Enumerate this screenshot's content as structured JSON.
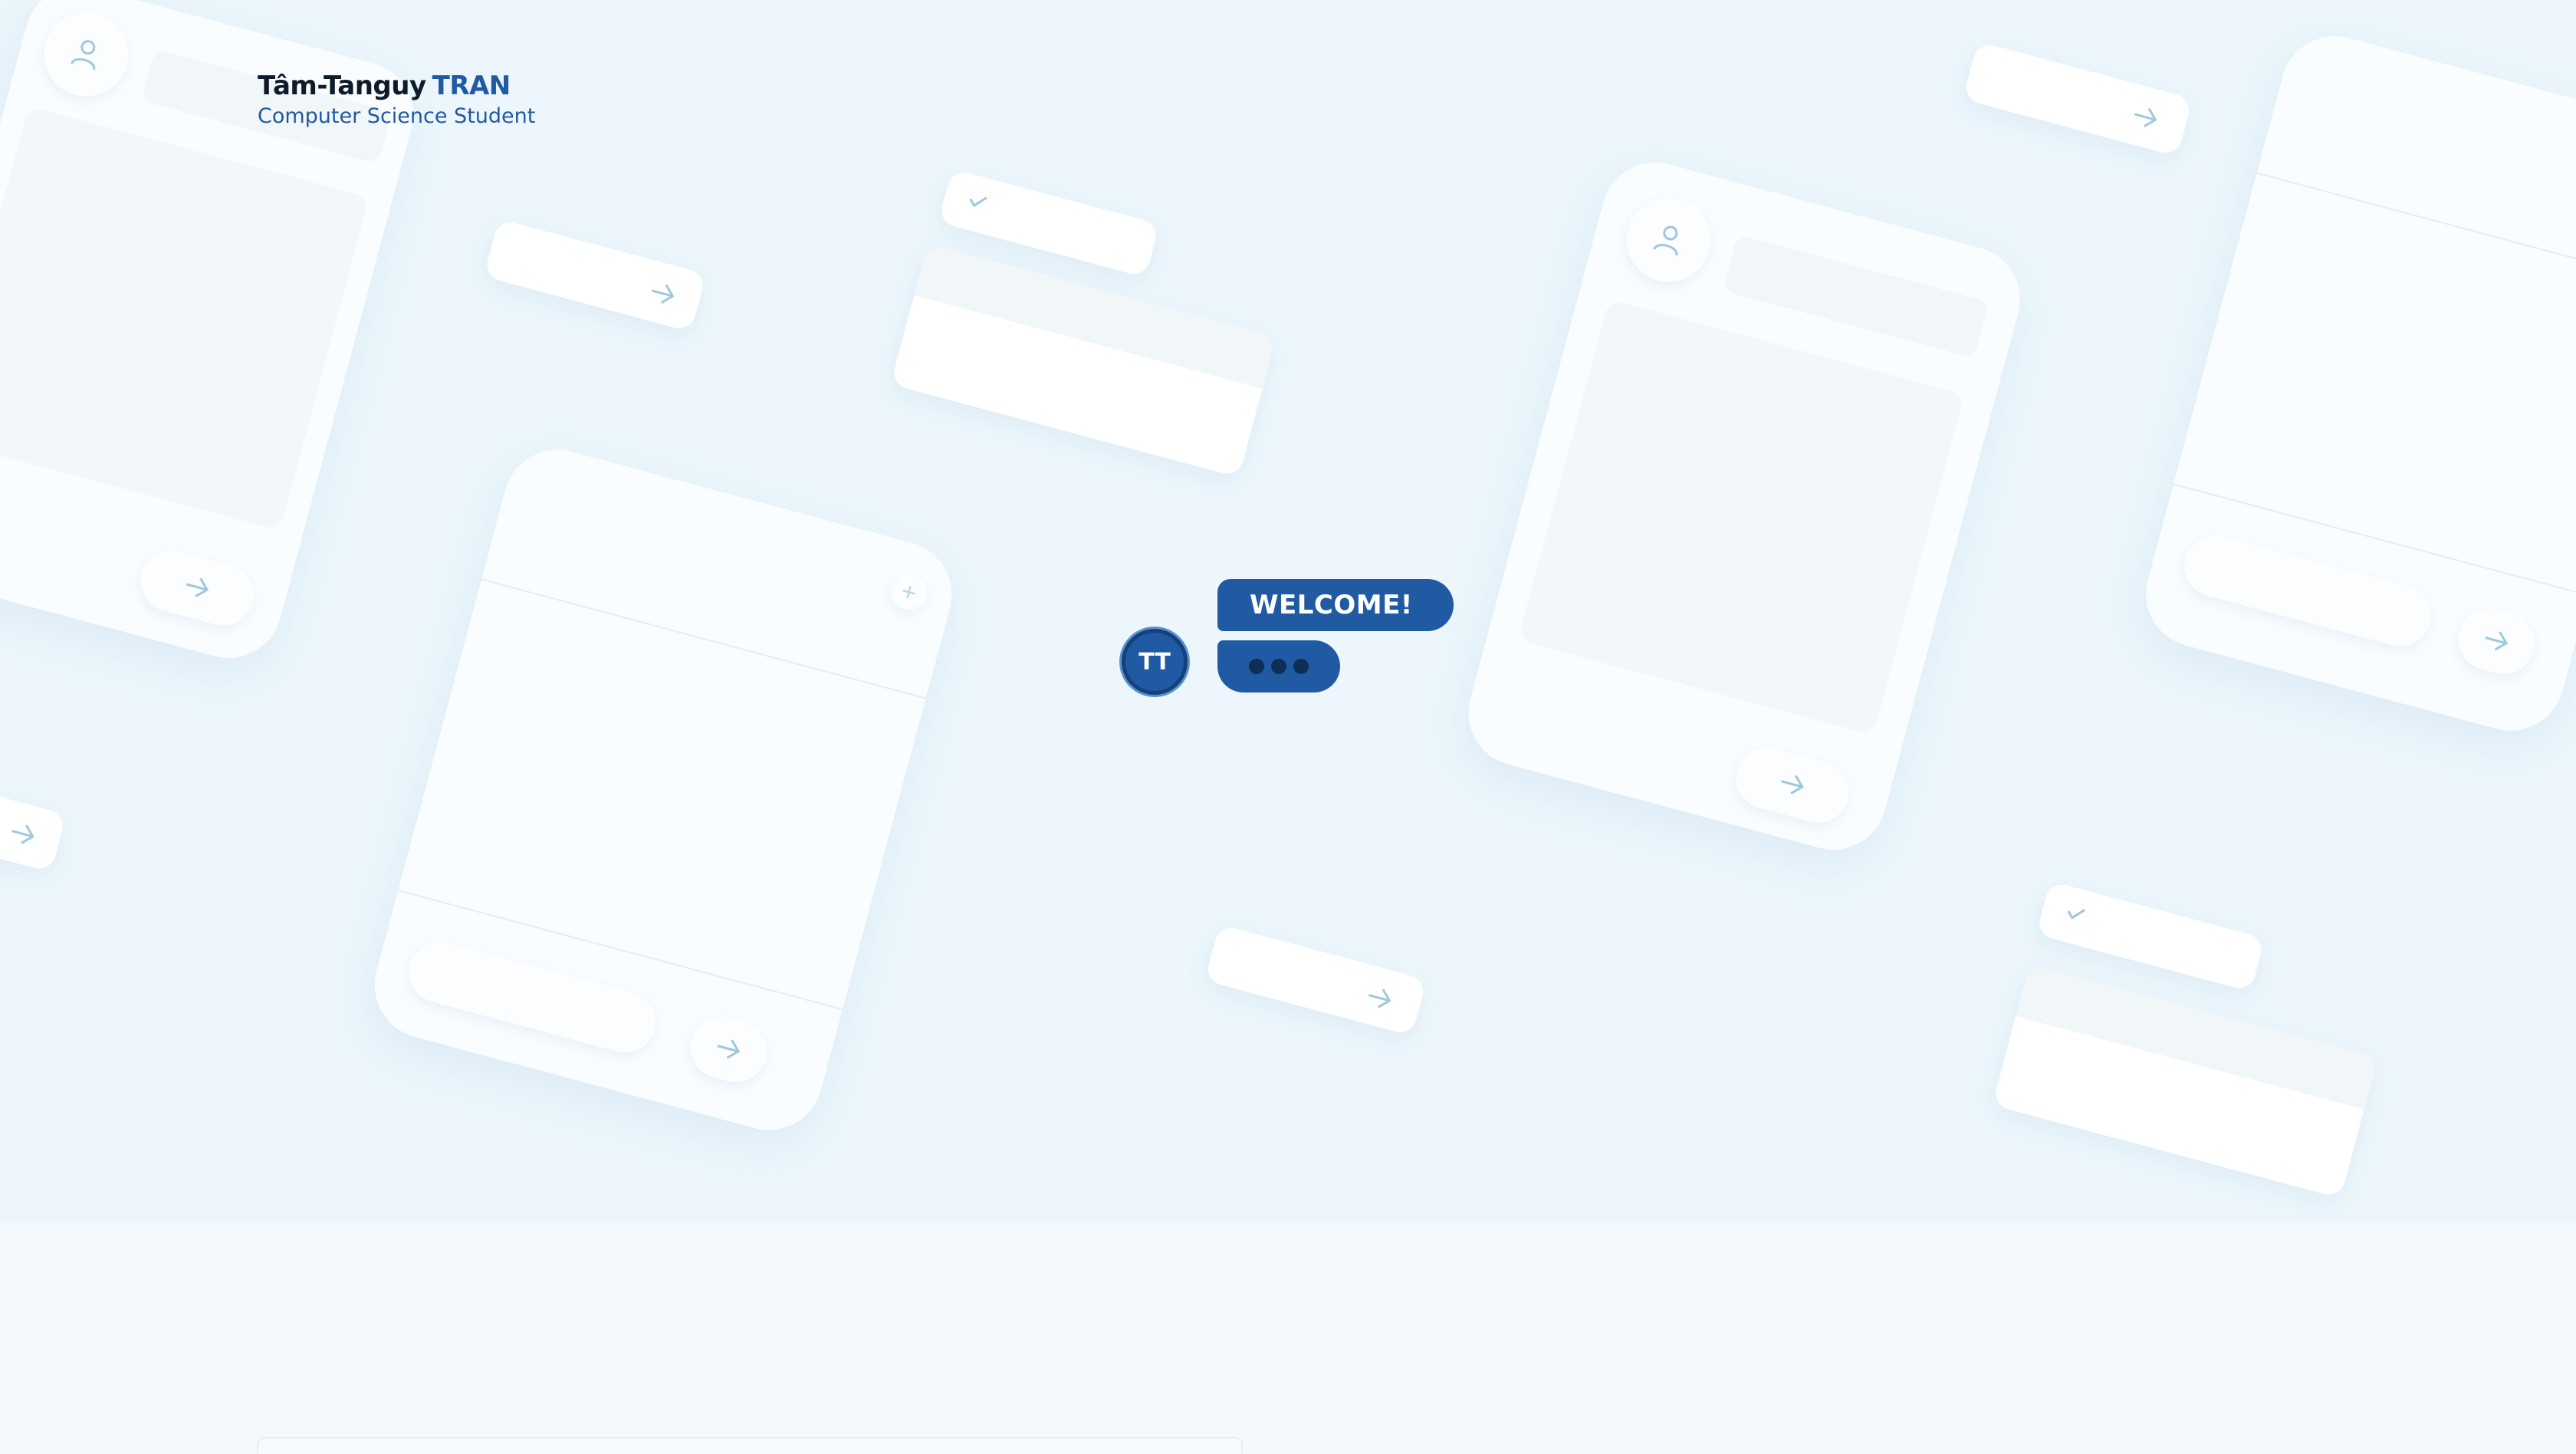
{
  "brand": {
    "first_name": "Tâm-Tanguy",
    "last_name": "TRAN",
    "subtitle": "Computer Science Student"
  },
  "chat": {
    "avatar_initials": "TT",
    "welcome_message": "WELCOME!",
    "typing_indicator_dots": 3
  },
  "colors": {
    "accent": "#1f5aa3",
    "accent_dark": "#154179",
    "hero_background": "#ecf6fc",
    "page_background": "#f3f9fd",
    "decor_icon": "#9fc7dd"
  },
  "decor_icons": [
    "user-icon",
    "arrow-right-icon",
    "checkmark-icon",
    "plus-icon"
  ]
}
